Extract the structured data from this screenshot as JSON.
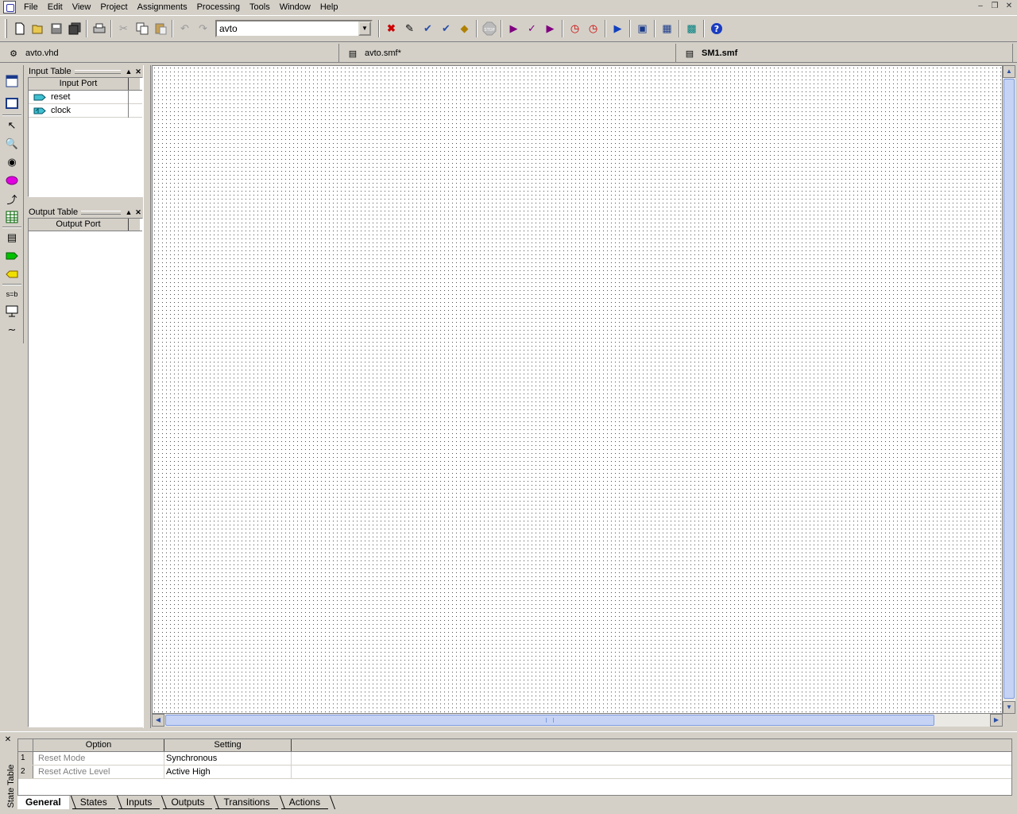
{
  "menu": {
    "items": [
      "File",
      "Edit",
      "View",
      "Project",
      "Assignments",
      "Processing",
      "Tools",
      "Window",
      "Help"
    ]
  },
  "toolbar": {
    "project_value": "avto",
    "icons": [
      "new-icon",
      "open-icon",
      "save-icon",
      "save-all-icon",
      "print-icon",
      "cut-icon",
      "copy-icon",
      "paste-icon",
      "undo-icon",
      "redo-icon",
      "compile-stop-icon",
      "pencil-icon",
      "analysis-icon",
      "synthesis-icon",
      "fitter-icon",
      "stop-icon",
      "start-compilation-icon",
      "start-analysis-icon",
      "start-timing-icon",
      "timing-analyzer-icon",
      "timequest-icon",
      "programmer-icon",
      "chip-planner-icon",
      "pin-planner-icon",
      "rtl-viewer-icon",
      "help-icon"
    ]
  },
  "doc_tabs": [
    {
      "label": "avto.vhd",
      "active": false
    },
    {
      "label": "avto.smf*",
      "active": false
    },
    {
      "label": "SM1.smf",
      "active": true
    }
  ],
  "input_table": {
    "title": "Input Table",
    "header": "Input Port",
    "ports": [
      "reset",
      "clock"
    ]
  },
  "output_table": {
    "title": "Output Table",
    "header": "Output Port",
    "ports": []
  },
  "state_table": {
    "side_label": "State Table",
    "headers": [
      "Option",
      "Setting"
    ],
    "rows": [
      {
        "num": "1",
        "option": "Reset Mode",
        "setting": "Synchronous"
      },
      {
        "num": "2",
        "option": "Reset Active Level",
        "setting": "Active High"
      }
    ],
    "tabs": [
      "General",
      "States",
      "Inputs",
      "Outputs",
      "Transitions",
      "Actions"
    ],
    "active_tab": "General"
  },
  "colors": {
    "chrome": "#d4d0c8",
    "scroll_thumb": "#c6d3f5",
    "accent_blue": "#2a4fa8"
  }
}
